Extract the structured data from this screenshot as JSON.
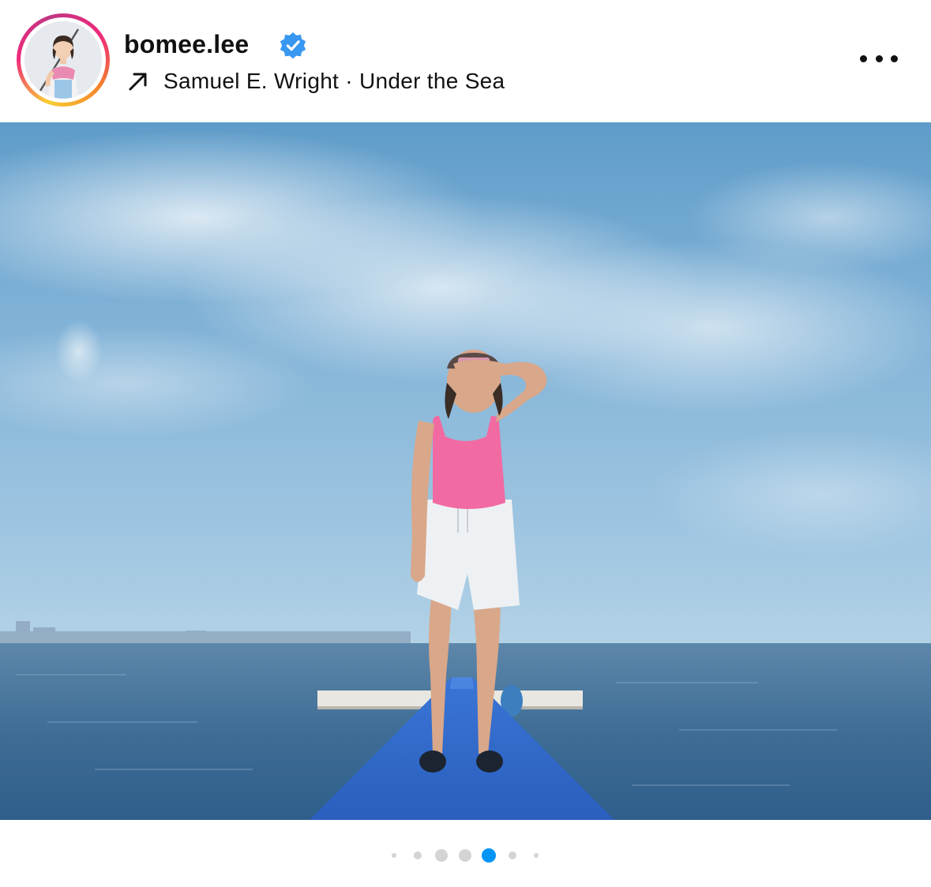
{
  "post": {
    "username": "bomee.lee",
    "verified": true,
    "music": {
      "artist": "Samuel E. Wright",
      "separator": " · ",
      "track": "Under the Sea",
      "icon": "arrow-up-right-icon"
    },
    "more_icon": "more-horizontal-icon",
    "mute_icon": "muted-speaker-icon"
  },
  "carousel": {
    "total_dots": 7,
    "active_index": 4
  },
  "colors": {
    "accent_blue": "#0095f6",
    "verified_blue": "#3897f0"
  }
}
